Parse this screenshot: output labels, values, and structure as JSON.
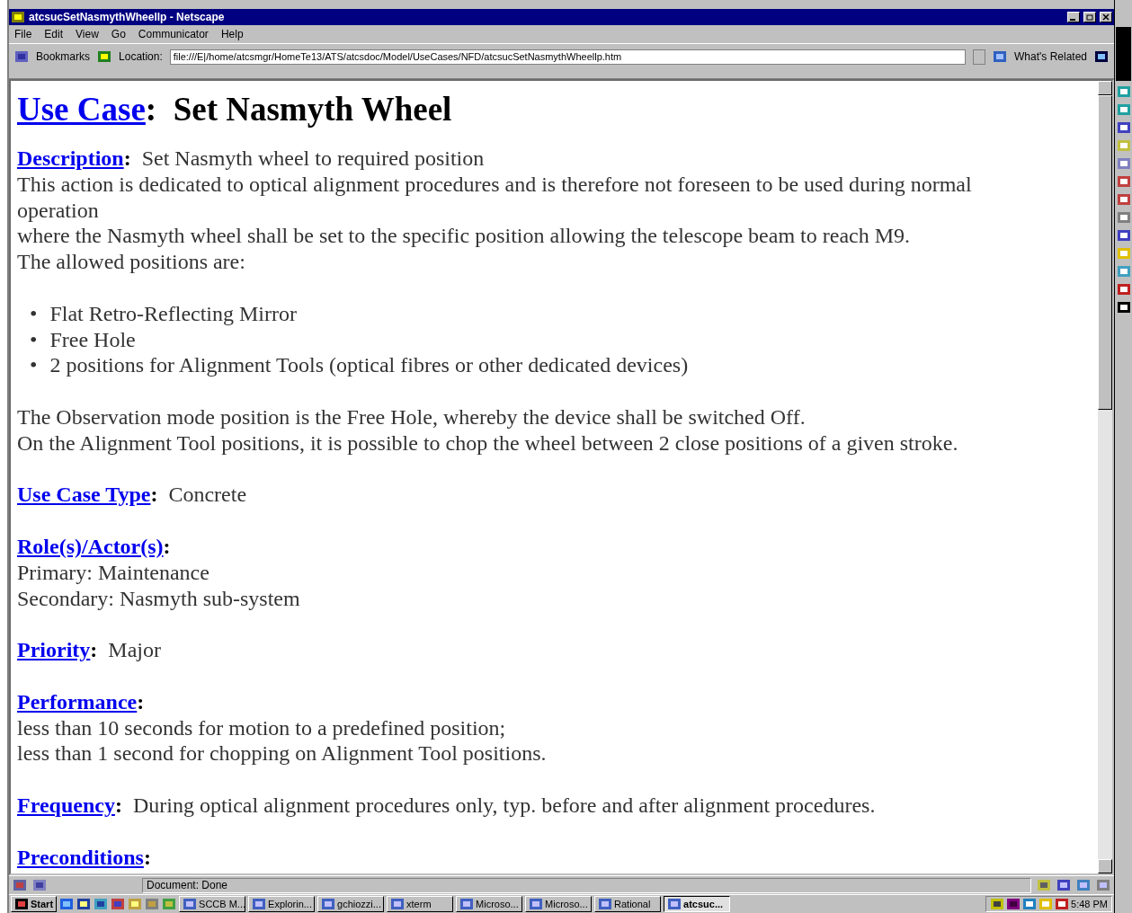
{
  "window": {
    "title": "atcsucSetNasmythWheellp - Netscape"
  },
  "menu": [
    "File",
    "Edit",
    "View",
    "Go",
    "Communicator",
    "Help"
  ],
  "toolbar": {
    "bookmarks": "Bookmarks",
    "location_label": "Location:",
    "url": "file:///E|/home/atcsmgr/HomeTe13/ATS/atcsdoc/Model/UseCases/NFD/atcsucSetNasmythWheellp.htm",
    "related": "What's Related"
  },
  "page": {
    "title_link": "Use Case",
    "title_separator": ":",
    "title": "Set Nasmyth Wheel",
    "blocks": [
      {
        "kind": "field",
        "label": "Description",
        "separator": ":",
        "value": "Set Nasmyth wheel to required position",
        "lines": [
          "This action is dedicated to optical alignment procedures and is therefore not foreseen to be used during normal operation",
          "where the Nasmyth wheel shall be set to the specific position allowing the telescope beam to reach M9.",
          "The allowed positions are:"
        ]
      },
      {
        "kind": "bullets",
        "items": [
          {
            "marker": "•",
            "text": "Flat Retro-Reflecting Mirror"
          },
          {
            "marker": "•",
            "text": "Free Hole"
          },
          {
            "marker": "•",
            "text": "2 positions for Alignment Tools (optical fibres or other dedicated devices)"
          }
        ]
      },
      {
        "kind": "para",
        "lines": [
          "The Observation mode position is the Free Hole, whereby the device shall be switched Off.",
          "On the Alignment Tool positions, it is possible to chop the wheel between 2 close positions of a given stroke."
        ]
      },
      {
        "kind": "field",
        "label": "Use Case Type",
        "separator": ":",
        "value": "Concrete"
      },
      {
        "kind": "field",
        "label": "Role(s)/Actor(s)",
        "separator": ":",
        "lines": [
          "Primary: Maintenance",
          "Secondary: Nasmyth sub-system"
        ]
      },
      {
        "kind": "field",
        "label": "Priority",
        "separator": ":",
        "value": "Major"
      },
      {
        "kind": "field",
        "label": "Performance",
        "separator": ":",
        "lines": [
          "less than 10 seconds for motion to a predefined position;",
          "less than 1 second for chopping on Alignment Tool positions."
        ]
      },
      {
        "kind": "field",
        "label": "Frequency",
        "separator": ":",
        "value": "During optical alignment procedures only, typ. before and after alignment procedures."
      },
      {
        "kind": "field",
        "label": "Preconditions",
        "separator": ":"
      }
    ]
  },
  "status_bar": {
    "text": "Document: Done"
  },
  "taskbar": {
    "start": "Start",
    "tasks": [
      {
        "label": "SCCB M...",
        "selected": false
      },
      {
        "label": "Explorin...",
        "selected": false
      },
      {
        "label": "gchiozzi...",
        "selected": false
      },
      {
        "label": "xterm",
        "selected": false
      },
      {
        "label": "Microso...",
        "selected": false
      },
      {
        "label": "Microso...",
        "selected": false
      },
      {
        "label": "Rational",
        "selected": false
      },
      {
        "label": "atcsuc...",
        "selected": true
      }
    ],
    "clock": "5:48 PM"
  }
}
